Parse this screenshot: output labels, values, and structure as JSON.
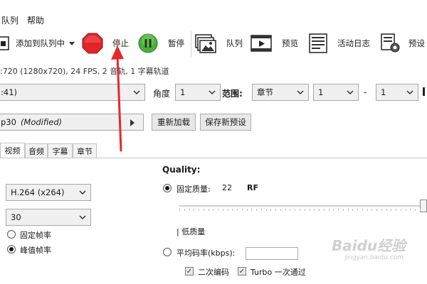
{
  "menu": {
    "queue": "队列",
    "help": "帮助"
  },
  "toolbar": {
    "add_to_queue": "添加到队列中",
    "stop": "停止",
    "pause": "暂停",
    "queue": "队列",
    "preview": "预览",
    "activity_log": "活动日志",
    "presets": "预设"
  },
  "source_info": ":720 (1280x720), 24 FPS, 2 音轨, 1 字幕轨道",
  "range": {
    "title_value": ":41)",
    "angle_label": "角度",
    "angle_value": "1",
    "range_label": "范围:",
    "range_type": "章节",
    "from": "1",
    "dash": "-",
    "to": "1"
  },
  "preset": {
    "name": "p30",
    "modified": "(Modified)",
    "reload_button": "重新加载",
    "save_button": "保存新预设"
  },
  "tabs": [
    "视频",
    "音频",
    "字幕",
    "章节"
  ],
  "video": {
    "codec": "H.264 (x264)",
    "framerate": "30",
    "const_fps": "固定帧率",
    "peak_fps": "峰值帧率",
    "quality_title": "Quality:",
    "const_quality_label": "固定质量:",
    "quality_value": "22",
    "quality_unit": "RF",
    "low_quality": "| 低质量",
    "avg_bitrate_label": "平均码率(kbps):",
    "avg_bitrate_value": "",
    "two_pass": "二次编码",
    "turbo": "Turbo 一次通过"
  },
  "watermark": {
    "text": "Baidu经验",
    "url": "jingyan.baidu.com"
  },
  "colors": {
    "stop_red": "#e0242a",
    "pause_green": "#4cae3b",
    "annotation_red": "#e8262b"
  },
  "icons": [
    "add-queue-icon",
    "stop-icon",
    "pause-icon",
    "queue-icon",
    "preview-icon",
    "activity-log-icon",
    "presets-icon"
  ]
}
